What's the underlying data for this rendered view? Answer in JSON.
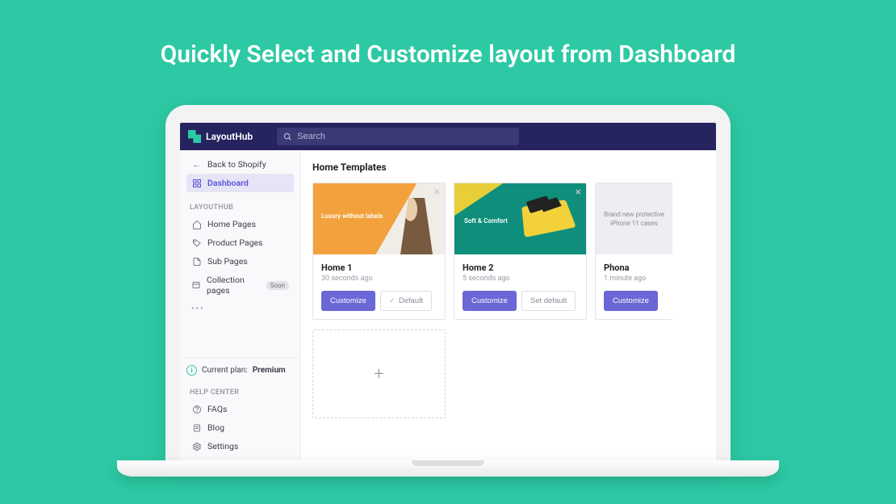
{
  "hero": {
    "title": "Quickly Select and Customize layout from Dashboard"
  },
  "topbar": {
    "brand": "LayoutHub",
    "search_placeholder": "Search"
  },
  "sidebar": {
    "back_label": "Back to Shopify",
    "dashboard_label": "Dashboard",
    "section_label": "LAYOUTHUB",
    "items": [
      {
        "label": "Home Pages"
      },
      {
        "label": "Product Pages"
      },
      {
        "label": "Sub Pages"
      },
      {
        "label": "Collection pages",
        "badge": "Soon"
      }
    ],
    "plan_prefix": "Current plan: ",
    "plan_value": "Premium",
    "help_label": "HELP CENTER",
    "help_items": [
      {
        "label": "FAQs"
      },
      {
        "label": "Blog"
      },
      {
        "label": "Settings"
      }
    ]
  },
  "main": {
    "title": "Home Templates",
    "cards": [
      {
        "thumb_line1": "Luxury without labels",
        "name": "Home 1",
        "time": "30 seconds ago",
        "primary": "Customize",
        "secondary": "Default"
      },
      {
        "thumb_line1": "Soft & Comfort",
        "name": "Home 2",
        "time": "5 seconds ago",
        "primary": "Customize",
        "secondary": "Set default"
      },
      {
        "thumb_line1": "Brand new protective",
        "thumb_line2": "iPhone 11 cases",
        "name": "Phona",
        "time": "1 minute ago",
        "primary": "Customize"
      }
    ]
  }
}
